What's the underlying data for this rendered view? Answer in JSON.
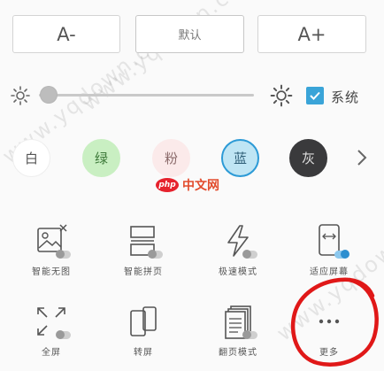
{
  "font_size": {
    "decrease_label": "A-",
    "default_label": "默认",
    "increase_label": "A+"
  },
  "brightness": {
    "level": 0.05,
    "system_label": "系统",
    "system_checked": true
  },
  "themes": [
    {
      "label": "白",
      "bg": "#ffffff",
      "fg": "#555555",
      "border": "#eeeeee"
    },
    {
      "label": "绿",
      "bg": "#c9efc2",
      "fg": "#3e7a3a",
      "border": "#c9efc2"
    },
    {
      "label": "粉",
      "bg": "#fbeaea",
      "fg": "#8a6a6a",
      "border": "#fbeaea"
    },
    {
      "label": "蓝",
      "bg": "#bfe5f4",
      "fg": "#2f5f78",
      "border": "#2c9ad6"
    },
    {
      "label": "灰",
      "bg": "#3a3a3c",
      "fg": "#dddddd",
      "border": "#3a3a3c"
    }
  ],
  "tools": [
    {
      "label": "智能无图",
      "icon": "no-image-icon"
    },
    {
      "label": "智能拼页",
      "icon": "page-join-icon"
    },
    {
      "label": "极速模式",
      "icon": "lightning-icon"
    },
    {
      "label": "适应屏幕",
      "icon": "fit-screen-icon"
    },
    {
      "label": "全屏",
      "icon": "fullscreen-icon"
    },
    {
      "label": "转屏",
      "icon": "rotate-screen-icon"
    },
    {
      "label": "翻页模式",
      "icon": "page-turn-icon"
    },
    {
      "label": "更多",
      "icon": "more-icon"
    }
  ],
  "accent_color": "#3aa4d8",
  "annotation_color": "#e01818",
  "watermark_text": "www.yqdown.com",
  "logo_text": {
    "php": "php",
    "cn": "中文网"
  }
}
